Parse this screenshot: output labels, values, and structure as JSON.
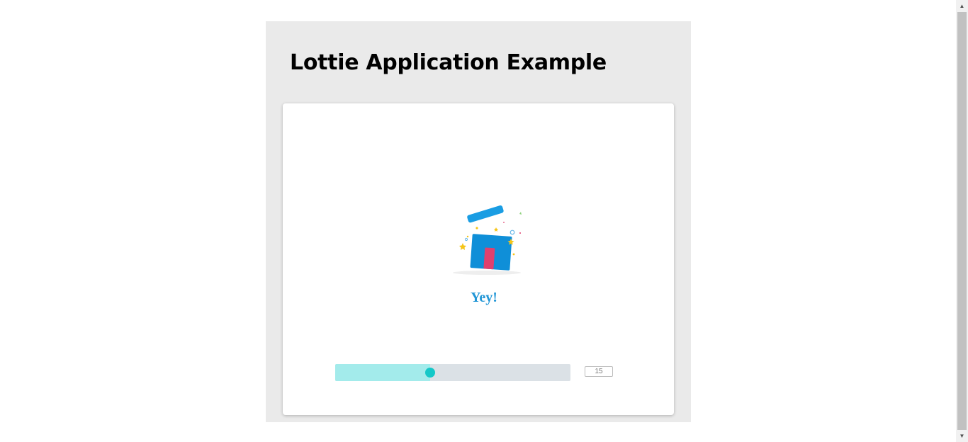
{
  "header": {
    "title": "Lottie Application Example"
  },
  "animation": {
    "icon": "gift-box-open-icon",
    "caption": "Yey!"
  },
  "player": {
    "progress_fraction": 0.405,
    "frame_value": "15"
  },
  "colors": {
    "panel_background": "#eaeaea",
    "caption": "#2196d6",
    "slider_track": "#dbe1e6",
    "slider_fill": "#a3ebeb",
    "slider_thumb": "#15c8c8",
    "box_blue": "#0f8fd8",
    "box_lid": "#1a9de3",
    "ribbon_pink": "#e0406e",
    "confetti_yellow": "#f5c518"
  }
}
